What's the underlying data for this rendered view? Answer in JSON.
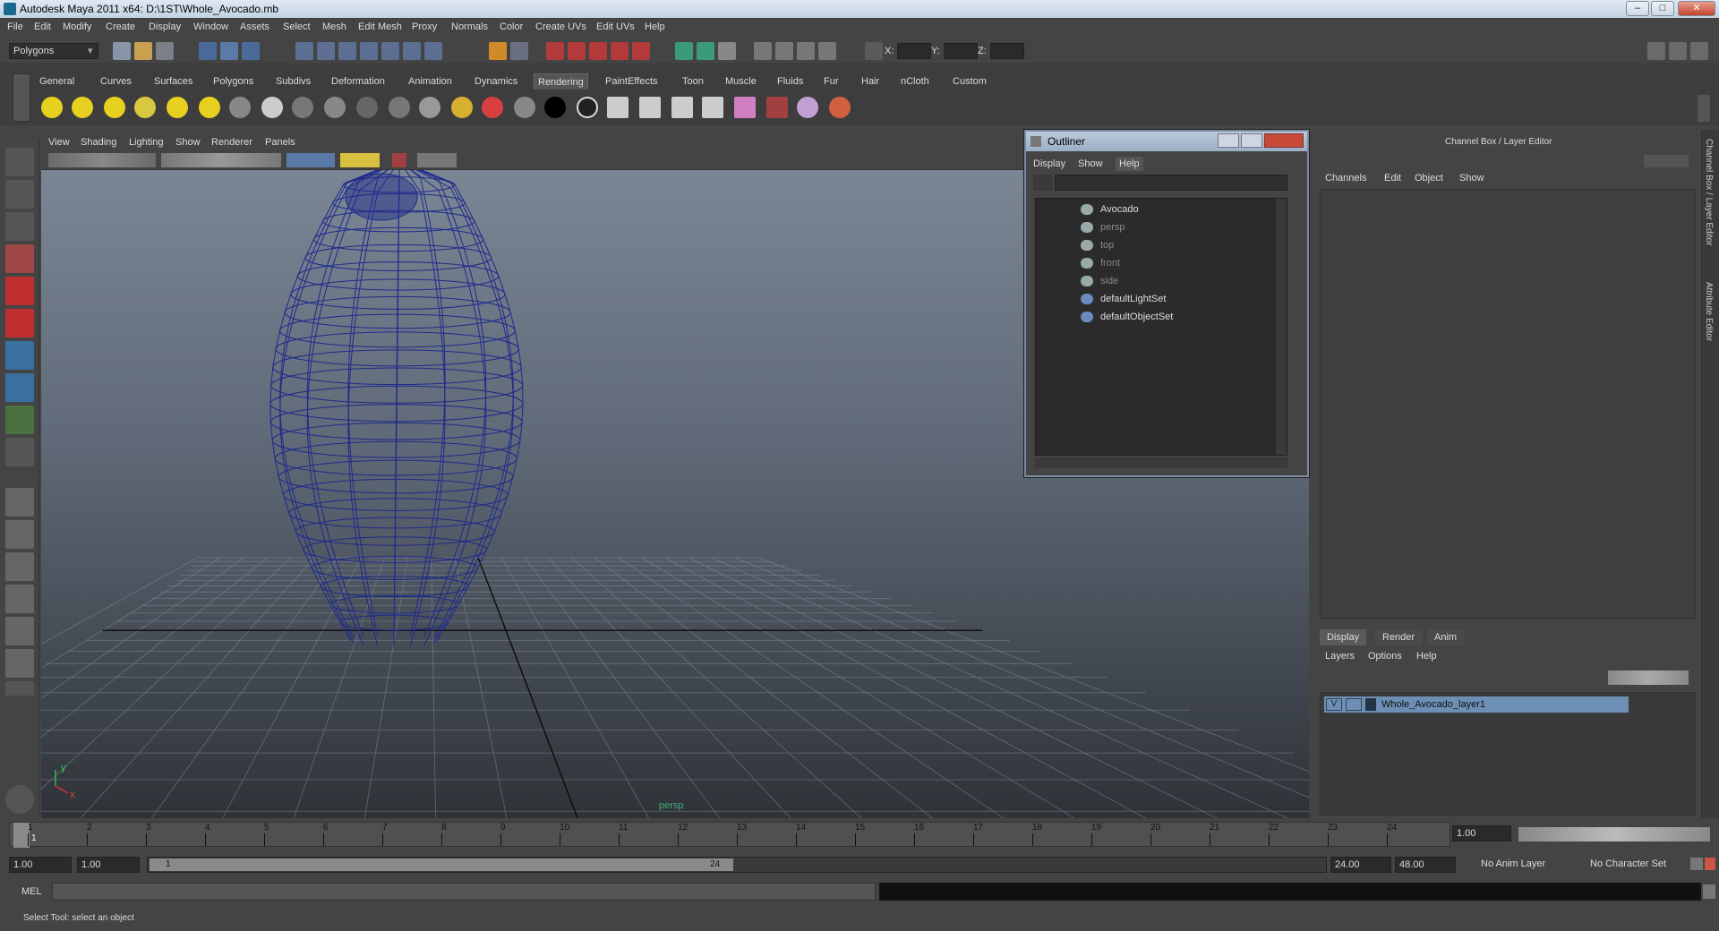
{
  "window": {
    "title": "Autodesk Maya 2011 x64: D:\\1ST\\Whole_Avocado.mb",
    "minimize": "–",
    "maximize": "□",
    "close": "✕"
  },
  "menubar": [
    "File",
    "Edit",
    "Modify",
    "Create",
    "Display",
    "Window",
    "Assets",
    "Select",
    "Mesh",
    "Edit Mesh",
    "Proxy",
    "Normals",
    "Color",
    "Create UVs",
    "Edit UVs",
    "Help"
  ],
  "statusline": {
    "mode": "Polygons",
    "x_label": "X:",
    "y_label": "Y:",
    "z_label": "Z:"
  },
  "shelf": {
    "tabs": [
      "General",
      "Curves",
      "Surfaces",
      "Polygons",
      "Subdivs",
      "Deformation",
      "Animation",
      "Dynamics",
      "Rendering",
      "PaintEffects",
      "Toon",
      "Muscle",
      "Fluids",
      "Fur",
      "Hair",
      "nCloth",
      "Custom"
    ],
    "active": "Rendering"
  },
  "viewport": {
    "menu": [
      "View",
      "Shading",
      "Lighting",
      "Show",
      "Renderer",
      "Panels"
    ],
    "camera_label": "persp",
    "axis_y": "y",
    "axis_x": "x",
    "wire_color": "#1e2a8c"
  },
  "outliner": {
    "title": "Outliner",
    "menu": [
      "Display",
      "Show",
      "Help"
    ],
    "items": [
      {
        "label": "Avocado",
        "dim": false
      },
      {
        "label": "persp",
        "dim": true
      },
      {
        "label": "top",
        "dim": true
      },
      {
        "label": "front",
        "dim": true
      },
      {
        "label": "side",
        "dim": true
      },
      {
        "label": "defaultLightSet",
        "dim": false
      },
      {
        "label": "defaultObjectSet",
        "dim": false
      }
    ]
  },
  "channelbox": {
    "title": "Channel Box / Layer Editor",
    "menu": [
      "Channels",
      "Edit",
      "Object",
      "Show"
    ],
    "layer_tabs": [
      "Display",
      "Render",
      "Anim"
    ],
    "layer_menu": [
      "Layers",
      "Options",
      "Help"
    ],
    "layer": {
      "visible": "V",
      "name": "Whole_Avocado_layer1"
    },
    "side_tabs": [
      "Channel Box / Layer Editor",
      "Attribute Editor"
    ]
  },
  "timeline": {
    "ticks": [
      "1",
      "2",
      "3",
      "4",
      "5",
      "6",
      "7",
      "8",
      "9",
      "10",
      "11",
      "12",
      "13",
      "14",
      "15",
      "16",
      "17",
      "18",
      "19",
      "20",
      "21",
      "22",
      "23",
      "24"
    ],
    "current_frame_box": "1",
    "current_time": "1.00"
  },
  "range": {
    "start_time": "1.00",
    "playback_start": "1.00",
    "slider_left": "1",
    "slider_right": "24",
    "playback_end": "24.00",
    "end_time": "48.00",
    "anim_layer": "No Anim Layer",
    "character_set": "No Character Set"
  },
  "cmdline": {
    "label": "MEL"
  },
  "helpline": {
    "text": "Select Tool: select an object"
  }
}
